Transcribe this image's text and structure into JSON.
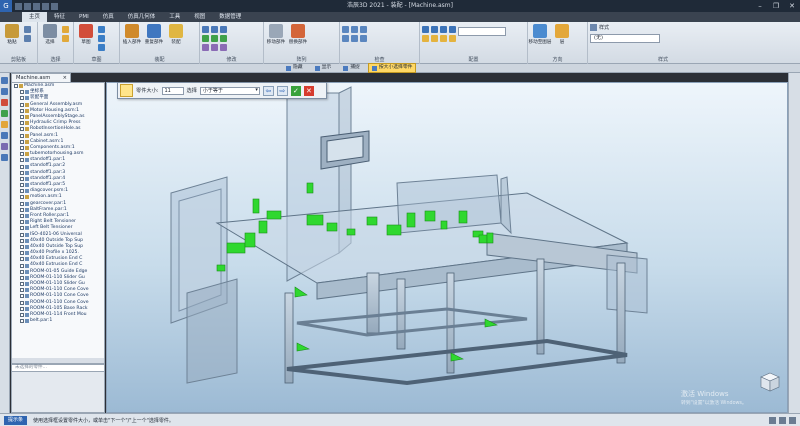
{
  "window": {
    "title": "浩辰3D 2021 - 装配 - [Machine.asm]",
    "controls": [
      "–",
      "❐",
      "✕"
    ]
  },
  "ribbon_tabs": [
    "主页",
    "特征",
    "PMI",
    "仿真",
    "仿真几何体",
    "工具",
    "视图",
    "数据管理"
  ],
  "ribbon_active_tab": 0,
  "ribbon_groups": [
    {
      "label": "剪贴板",
      "buttons": [
        "粘贴"
      ]
    },
    {
      "label": "选择",
      "buttons": [
        "选择"
      ]
    },
    {
      "label": "草图",
      "buttons": [
        "草图"
      ]
    },
    {
      "label": "装配",
      "buttons": [
        "插入部件",
        "重复部件",
        "装配"
      ]
    },
    {
      "label": "修改",
      "buttons": []
    },
    {
      "label": "阵列",
      "buttons": [
        "移动部件",
        "替换部件"
      ]
    },
    {
      "label": "检查",
      "buttons": []
    },
    {
      "label": "配置",
      "buttons": []
    },
    {
      "label": "方向",
      "buttons": [
        "移动至图层",
        "层"
      ]
    },
    {
      "label": "样式",
      "buttons": [
        "样式"
      ],
      "select": "(无)"
    }
  ],
  "subtoolbar": [
    {
      "label": "隐藏",
      "active": false
    },
    {
      "label": "显示",
      "active": false
    },
    {
      "label": "捕捉",
      "active": false
    },
    {
      "label": "按大小选择零件",
      "active": true
    }
  ],
  "doc_tab": {
    "label": "Machine.asm",
    "close": "×"
  },
  "tree": {
    "items": [
      {
        "name": "Machine.asm",
        "level": 0,
        "sub": true
      },
      {
        "name": "坐标系",
        "level": 1,
        "sub": false
      },
      {
        "name": "装配平面",
        "level": 1,
        "sub": false
      },
      {
        "name": "General Assembly.asm",
        "level": 1,
        "sub": true
      },
      {
        "name": "Motor Housing.asm:1",
        "level": 1,
        "sub": true
      },
      {
        "name": "PanelAssemblyStage.as",
        "level": 1,
        "sub": true
      },
      {
        "name": "Hydraulic Crimp Press",
        "level": 1,
        "sub": true
      },
      {
        "name": "RobotInsertionHole.as",
        "level": 1,
        "sub": true
      },
      {
        "name": "Panel.asm:1",
        "level": 1,
        "sub": true
      },
      {
        "name": "Cabinet.asm:1",
        "level": 1,
        "sub": true
      },
      {
        "name": "Components.asm:1",
        "level": 1,
        "sub": true
      },
      {
        "name": "tubemotorhousing.asm",
        "level": 1,
        "sub": true
      },
      {
        "name": "standoff1.par:1",
        "level": 1,
        "sub": false
      },
      {
        "name": "standoff1.par:2",
        "level": 1,
        "sub": false
      },
      {
        "name": "standoff1.par:3",
        "level": 1,
        "sub": false
      },
      {
        "name": "standoff1.par:4",
        "level": 1,
        "sub": false
      },
      {
        "name": "standoff1.par:5",
        "level": 1,
        "sub": false
      },
      {
        "name": "diagcover.psm:1",
        "level": 1,
        "sub": false
      },
      {
        "name": "motion.asm:1",
        "level": 1,
        "sub": true
      },
      {
        "name": "gearcover.par:1",
        "level": 1,
        "sub": false
      },
      {
        "name": "BaltFrame.par:1",
        "level": 1,
        "sub": false
      },
      {
        "name": "Front Roller.par:1",
        "level": 1,
        "sub": false
      },
      {
        "name": "Right Belt Tensioner",
        "level": 1,
        "sub": false
      },
      {
        "name": "Left Belt Tensioner",
        "level": 1,
        "sub": false
      },
      {
        "name": "ISO-4021-06 Universal",
        "level": 1,
        "sub": false
      },
      {
        "name": "40x40 Outside Top Sup",
        "level": 1,
        "sub": false
      },
      {
        "name": "40x40 Outside Top Sup",
        "level": 1,
        "sub": false
      },
      {
        "name": "40x40 Profile x 1025.",
        "level": 1,
        "sub": false
      },
      {
        "name": "40x40 Extrusion End C",
        "level": 1,
        "sub": false
      },
      {
        "name": "40x40 Extrusion End C",
        "level": 1,
        "sub": false
      },
      {
        "name": "ROOM-01-05 Guide Edge",
        "level": 1,
        "sub": false
      },
      {
        "name": "ROOM-01-110 Slider Gu",
        "level": 1,
        "sub": false
      },
      {
        "name": "ROOM-01-110 Slider Gu",
        "level": 1,
        "sub": false
      },
      {
        "name": "ROOM-01-110 Cone Cove",
        "level": 1,
        "sub": false
      },
      {
        "name": "ROOM-01-110 Cone Cove",
        "level": 1,
        "sub": false
      },
      {
        "name": "ROOM-01-110 Cone Cove",
        "level": 1,
        "sub": false
      },
      {
        "name": "ROOM-01-105 Base Rack",
        "level": 1,
        "sub": false
      },
      {
        "name": "ROOM-01-114 Front Mou",
        "level": 1,
        "sub": false
      },
      {
        "name": "belt.par:1",
        "level": 1,
        "sub": false
      }
    ]
  },
  "filter_placeholder": "未选择的零件...",
  "command_bar": {
    "size_label": "零件大小:",
    "size_value": "11",
    "select_label": "选择",
    "select_value": "小于等于",
    "prev": "⇦",
    "next": "⇨",
    "ok": "✓",
    "cancel": "✕"
  },
  "watermark": {
    "line1": "激活 Windows",
    "line2": "转到\"设置\"以激活 Windows。"
  },
  "status": {
    "label": "提示条",
    "message": "使用选择框设置零件大小，或单击\"下一个\"/\"上一个\"选择零件。"
  },
  "colors": {
    "highlight_green": "#2fd82f",
    "title_bar": "#1f2a38",
    "accent": "#2e64b0"
  }
}
